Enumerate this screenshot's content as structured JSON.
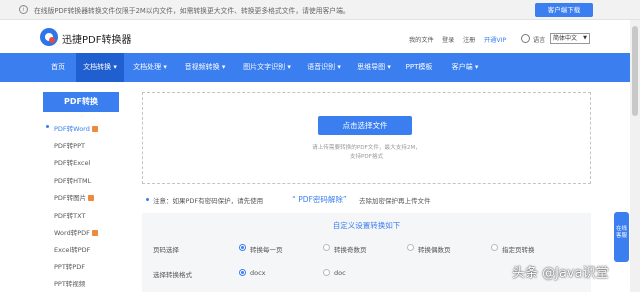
{
  "notice": {
    "text": "在线版PDF转换器转换文件仅限于2M以内文件，如需转换更大文件、转换更多格式文件，请使用客户端。",
    "download_button": "客户端下载"
  },
  "header": {
    "brand": "迅捷PDF转换器",
    "links": [
      "我的文件",
      "登录",
      "注册",
      "开通VIP"
    ],
    "lang_label": "语言",
    "lang_value": "简体中文"
  },
  "nav": {
    "items": [
      "首页",
      "文档转换",
      "文档处理",
      "音视频转换",
      "图片文字识别",
      "语音识别",
      "思维导图",
      "PPT模板",
      "客户端"
    ],
    "active_index": 1
  },
  "sidebar": {
    "title": "PDF转换",
    "items": [
      {
        "label": "PDF转Word",
        "badge": true,
        "active": true
      },
      {
        "label": "PDF转PPT",
        "badge": false,
        "active": false
      },
      {
        "label": "PDF转Excel",
        "badge": false,
        "active": false
      },
      {
        "label": "PDF转HTML",
        "badge": false,
        "active": false
      },
      {
        "label": "PDF转图片",
        "badge": true,
        "active": false
      },
      {
        "label": "PDF转TXT",
        "badge": false,
        "active": false
      },
      {
        "label": "Word转PDF",
        "badge": true,
        "active": false
      },
      {
        "label": "Excel转PDF",
        "badge": false,
        "active": false
      },
      {
        "label": "PPT转PDF",
        "badge": false,
        "active": false
      },
      {
        "label": "PPT转视频",
        "badge": false,
        "active": false
      }
    ]
  },
  "upload": {
    "button": "点击选择文件",
    "hint1": "请上传需要转换的PDF文件，最大支持2M，",
    "hint2": "支持PDF格式"
  },
  "note": {
    "text": "注意：如果PDF有密码保护，请先使用",
    "link": "“ PDF密码解除”",
    "text2": "去除加密保护再上传文件"
  },
  "settings": {
    "title": "自定义设置转换如下",
    "page_label": "页码选择",
    "page_options": [
      "转换每一页",
      "转换奇数页",
      "转换偶数页",
      "指定页转换"
    ],
    "page_selected": 0,
    "format_label": "选择转换格式",
    "format_options": [
      "docx",
      "doc"
    ],
    "format_selected": 0
  },
  "widget": {
    "text": "在线客服"
  },
  "watermark": "头条 @Java识堂",
  "colors": {
    "accent": "#3a7ef0",
    "nav_active": "#1f5fd0",
    "badge": "#f08a3a"
  }
}
